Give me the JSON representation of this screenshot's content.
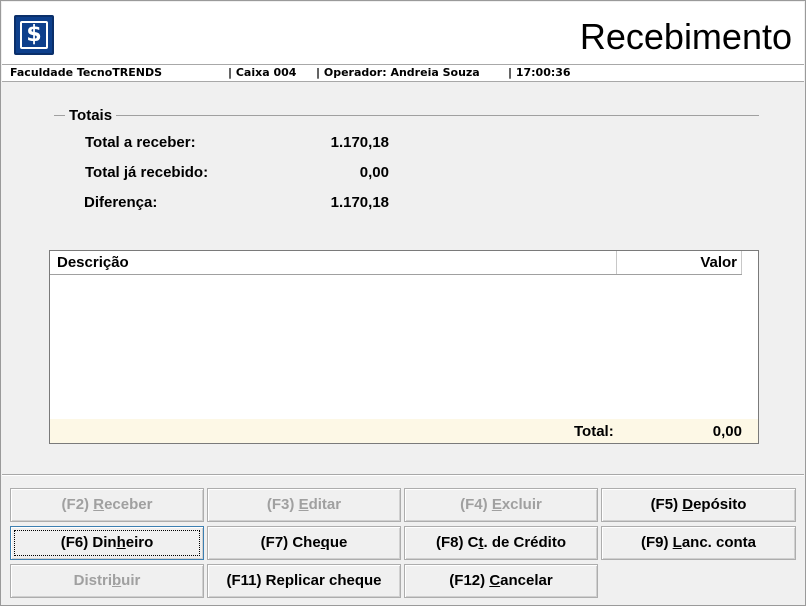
{
  "window": {
    "title": "Recebimento",
    "logo_glyph": "$",
    "logo_color": "#0d3f8c"
  },
  "info": {
    "company": "Faculdade TecnoTRENDS",
    "caixa": "| Caixa 004",
    "operator": "| Operador: Andreia Souza",
    "time": "| 17:00:36"
  },
  "totals": {
    "group_title": "Totais",
    "a_receber_label": "Total a receber:",
    "a_receber_value": "1.170,18",
    "ja_recebido_label": "Total já recebido:",
    "ja_recebido_value": "0,00",
    "diferenca_label": "Diferença:",
    "diferenca_value": "1.170,18"
  },
  "grid": {
    "columns": [
      "Descrição",
      "Valor"
    ],
    "rows": [],
    "total_label": "Total:",
    "total_value": "0,00"
  },
  "buttons": [
    {
      "pre": "(F2) ",
      "hot": "R",
      "post": "eceber",
      "enabled": false
    },
    {
      "pre": "(F3) ",
      "hot": "E",
      "post": "ditar",
      "enabled": false
    },
    {
      "pre": "(F4) ",
      "hot": "E",
      "post": "xcluir",
      "enabled": false
    },
    {
      "pre": "(F5) ",
      "hot": "D",
      "post": "epósito",
      "enabled": true
    },
    {
      "pre": "(F6) Din",
      "hot": "h",
      "post": "eiro",
      "enabled": true,
      "focused": true
    },
    {
      "pre": "(F7) Che",
      "hot": "q",
      "post": "ue",
      "enabled": true
    },
    {
      "pre": "(F8) C",
      "hot": "t",
      "post": ". de Crédito",
      "enabled": true
    },
    {
      "pre": "(F9) ",
      "hot": "L",
      "post": "anc. conta",
      "enabled": true
    },
    {
      "pre": "Distri",
      "hot": "b",
      "post": "uir",
      "enabled": false
    },
    {
      "pre": "(F11) Replicar cheque",
      "hot": "",
      "post": "",
      "enabled": true
    },
    {
      "pre": "(F12) ",
      "hot": "C",
      "post": "ancelar",
      "enabled": true
    }
  ]
}
